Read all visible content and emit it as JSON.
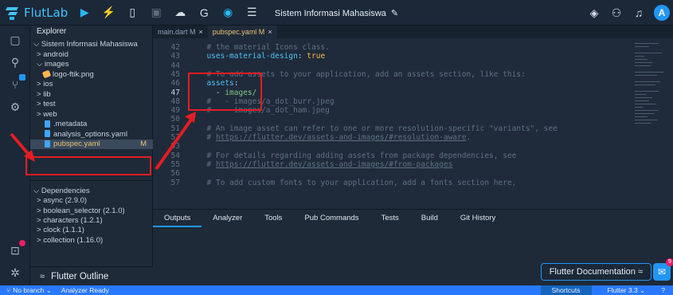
{
  "app": {
    "brand": "FlutLab",
    "project_title": "Sistem Informasi Mahasiswa",
    "avatar_letter": "A"
  },
  "explorer": {
    "title": "Explorer",
    "items": [
      {
        "label": "Sistem Informasi Mahasiswa",
        "prefix": "⌵ ",
        "indent": 4
      },
      {
        "label": "android",
        "prefix": "> ",
        "indent": 8
      },
      {
        "label": "images",
        "prefix": "⌵ ",
        "indent": 8
      },
      {
        "label": "logo-ftik.png",
        "prefix": "",
        "indent": 16,
        "icon": "image"
      },
      {
        "label": "ios",
        "prefix": "> ",
        "indent": 8
      },
      {
        "label": "lib",
        "prefix": "> ",
        "indent": 8
      },
      {
        "label": "test",
        "prefix": "> ",
        "indent": 8
      },
      {
        "label": "web",
        "prefix": "> ",
        "indent": 8
      },
      {
        "label": ".metadata",
        "prefix": "",
        "indent": 18,
        "icon": "file"
      },
      {
        "label": "analysis_options.yaml",
        "prefix": "",
        "indent": 18,
        "icon": "file"
      },
      {
        "label": "pubspec.yaml",
        "prefix": "",
        "indent": 18,
        "icon": "file",
        "selected": true,
        "badge": "M"
      }
    ],
    "dependencies": [
      {
        "label": "Dependencies",
        "prefix": "⌵ ",
        "indent": 4
      },
      {
        "label": "async (2.9.0)",
        "prefix": "> ",
        "indent": 8
      },
      {
        "label": "boolean_selector (2.1.0)",
        "prefix": "> ",
        "indent": 8
      },
      {
        "label": "characters (1.2.1)",
        "prefix": "> ",
        "indent": 8
      },
      {
        "label": "clock (1.1.1)",
        "prefix": "> ",
        "indent": 8
      },
      {
        "label": "collection (1.16.0)",
        "prefix": "> ",
        "indent": 8
      }
    ],
    "outline": "Flutter Outline"
  },
  "editor": {
    "tabs": [
      {
        "label": "main.dart M",
        "active": false
      },
      {
        "label": "pubspec.yaml M",
        "active": true
      }
    ],
    "lines": [
      {
        "n": "42",
        "parts": [
          [
            "cm",
            "  # the material Icons class."
          ]
        ]
      },
      {
        "n": "43",
        "parts": [
          [
            "key",
            "  uses-material-design"
          ],
          [
            "plain",
            ": "
          ],
          [
            "boolv",
            "true"
          ]
        ]
      },
      {
        "n": "44",
        "parts": []
      },
      {
        "n": "45",
        "parts": [
          [
            "cm",
            "  # To add assets to your application, add an assets section, like this:"
          ]
        ]
      },
      {
        "n": "46",
        "parts": [
          [
            "key",
            "  assets"
          ],
          [
            "plain",
            ":"
          ]
        ]
      },
      {
        "n": "47",
        "parts": [
          [
            "plain",
            "    - "
          ],
          [
            "val",
            "images/"
          ]
        ],
        "current": true
      },
      {
        "n": "48",
        "parts": [
          [
            "cm",
            "  #   - images/a_dot_burr.jpeg"
          ]
        ]
      },
      {
        "n": "49",
        "parts": [
          [
            "cm",
            "  #   - images/a_dot_ham.jpeg"
          ]
        ]
      },
      {
        "n": "50",
        "parts": []
      },
      {
        "n": "51",
        "parts": [
          [
            "cm",
            "  # An image asset can refer to one or more resolution-specific \"variants\", see"
          ]
        ]
      },
      {
        "n": "52",
        "parts": [
          [
            "cm",
            "  # "
          ],
          [
            "cm link",
            "https://flutter.dev/assets-and-images/#resolution-aware"
          ],
          [
            "cm",
            "."
          ]
        ]
      },
      {
        "n": "53",
        "parts": []
      },
      {
        "n": "54",
        "parts": [
          [
            "cm",
            "  # For details regarding adding assets from package dependencies, see"
          ]
        ]
      },
      {
        "n": "55",
        "parts": [
          [
            "cm",
            "  # "
          ],
          [
            "cm link",
            "https://flutter.dev/assets-and-images/#from-packages"
          ]
        ]
      },
      {
        "n": "56",
        "parts": []
      },
      {
        "n": "57",
        "parts": [
          [
            "cm",
            "  # To add custom fonts to your application, add a fonts section here,"
          ]
        ]
      }
    ]
  },
  "bottom_panel": {
    "tabs": [
      "Outputs",
      "Analyzer",
      "Tools",
      "Pub Commands",
      "Tests",
      "Build",
      "Git History"
    ],
    "doc_button": "Flutter Documentation ≈",
    "chat_badge": "9"
  },
  "status": {
    "branch": "No branch ⌄",
    "analyzer": "Analyzer Ready",
    "shortcuts": "Shortcuts",
    "flutter_version": "Flutter 3.3 ⌄",
    "help": "?"
  },
  "colors": {
    "accent": "#2196f3",
    "annotation": "#e51c23",
    "modified": "#e8c070"
  }
}
